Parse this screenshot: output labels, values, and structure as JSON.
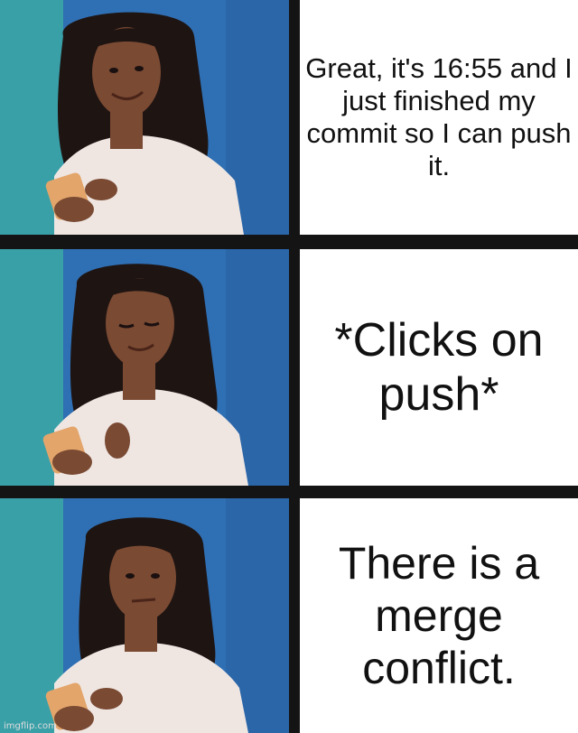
{
  "panels": [
    {
      "caption": "Great, it's 16:55 and I just finished my commit so I can push it.",
      "expression": "smile"
    },
    {
      "caption": "*Clicks on push*",
      "expression": "look-down"
    },
    {
      "caption": "There is a merge conflict.",
      "expression": "skeptical"
    }
  ],
  "watermark": "imgflip.com",
  "colors": {
    "background_blue": "#2f6fb3",
    "background_teal": "#3aa0a8",
    "divider": "#141414",
    "caption_bg": "#ffffff",
    "hair": "#1e1412",
    "skin": "#7a4a33",
    "blouse": "#efe6e2",
    "phone": "#e3a56a"
  }
}
